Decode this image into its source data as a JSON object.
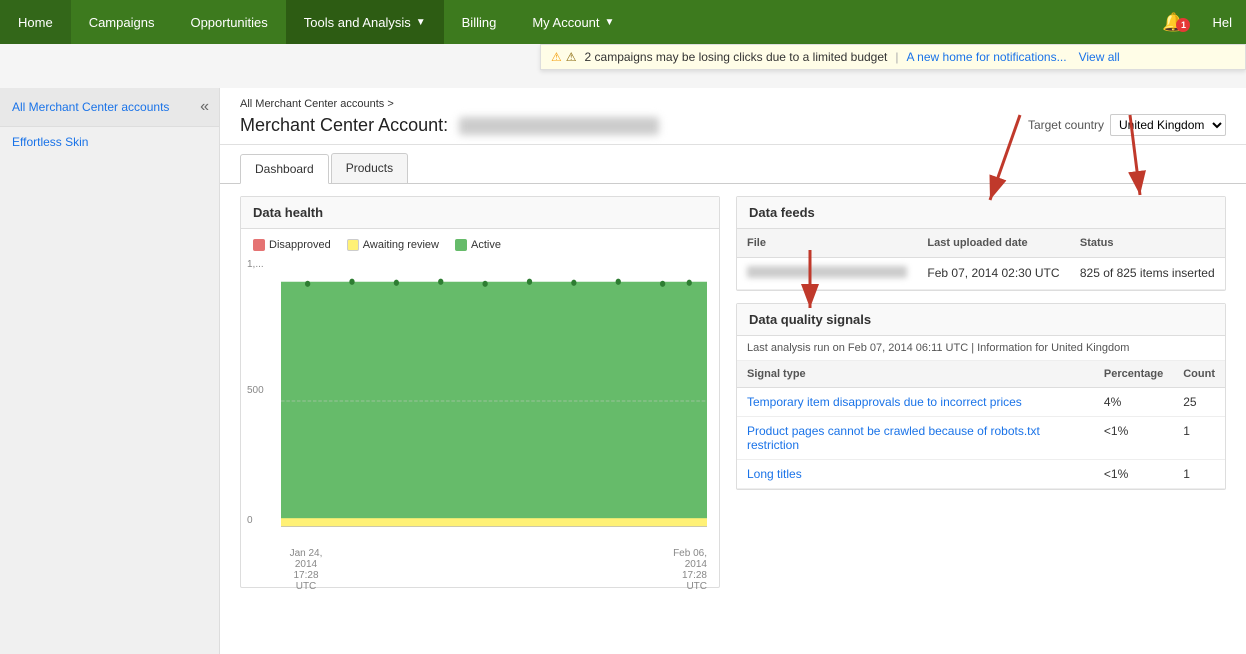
{
  "nav": {
    "items": [
      {
        "label": "Home",
        "active": false
      },
      {
        "label": "Campaigns",
        "active": false
      },
      {
        "label": "Opportunities",
        "active": false
      },
      {
        "label": "Tools and Analysis",
        "active": true,
        "hasArrow": true
      },
      {
        "label": "Billing",
        "active": false
      },
      {
        "label": "My Account",
        "active": false,
        "hasArrow": true
      }
    ],
    "help": "Hel",
    "bell_badge": "1"
  },
  "notification": {
    "warning_text": "2 campaigns may be losing clicks due to a limited budget",
    "link_text": "A new home for notifications...",
    "view_all": "View all"
  },
  "sidebar": {
    "title": "All Merchant Center accounts",
    "account_name": "Effortless Skin"
  },
  "breadcrumb": {
    "link": "All Merchant Center accounts",
    "separator": ">"
  },
  "page": {
    "title": "Merchant Center Account:",
    "target_country_label": "Target country",
    "target_country_value": "United Kingdom"
  },
  "tabs": [
    {
      "label": "Dashboard",
      "active": true
    },
    {
      "label": "Products",
      "active": false
    }
  ],
  "data_health": {
    "title": "Data health",
    "legend": [
      {
        "label": "Disapproved",
        "color": "#e57373"
      },
      {
        "label": "Awaiting review",
        "color": "#fff176"
      },
      {
        "label": "Active",
        "color": "#66bb6a"
      }
    ],
    "y_label_1": "1,...",
    "y_label_500": "500",
    "y_label_0": "0",
    "x_labels": [
      {
        "line1": "Jan 24,",
        "line2": "2014",
        "line3": "17:28",
        "line4": "UTC"
      },
      {
        "line1": "Feb 06,",
        "line2": "2014",
        "line3": "17:28",
        "line4": "UTC"
      }
    ]
  },
  "data_feeds": {
    "title": "Data feeds",
    "columns": [
      "File",
      "Last uploaded date",
      "Status"
    ],
    "rows": [
      {
        "file": "BLURRED",
        "last_uploaded": "Feb 07, 2014 02:30 UTC",
        "status": "825 of 825 items inserted"
      }
    ]
  },
  "data_quality": {
    "title": "Data quality signals",
    "meta": "Last analysis run on Feb 07, 2014 06:11 UTC | Information for United Kingdom",
    "columns": [
      "Signal type",
      "Percentage",
      "Count"
    ],
    "rows": [
      {
        "signal": "Temporary item disapprovals due to incorrect prices",
        "percentage": "4%",
        "count": "25"
      },
      {
        "signal": "Product pages cannot be crawled because of robots.txt restriction",
        "percentage": "<1%",
        "count": "1"
      },
      {
        "signal": "Long titles",
        "percentage": "<1%",
        "count": "1"
      }
    ]
  }
}
